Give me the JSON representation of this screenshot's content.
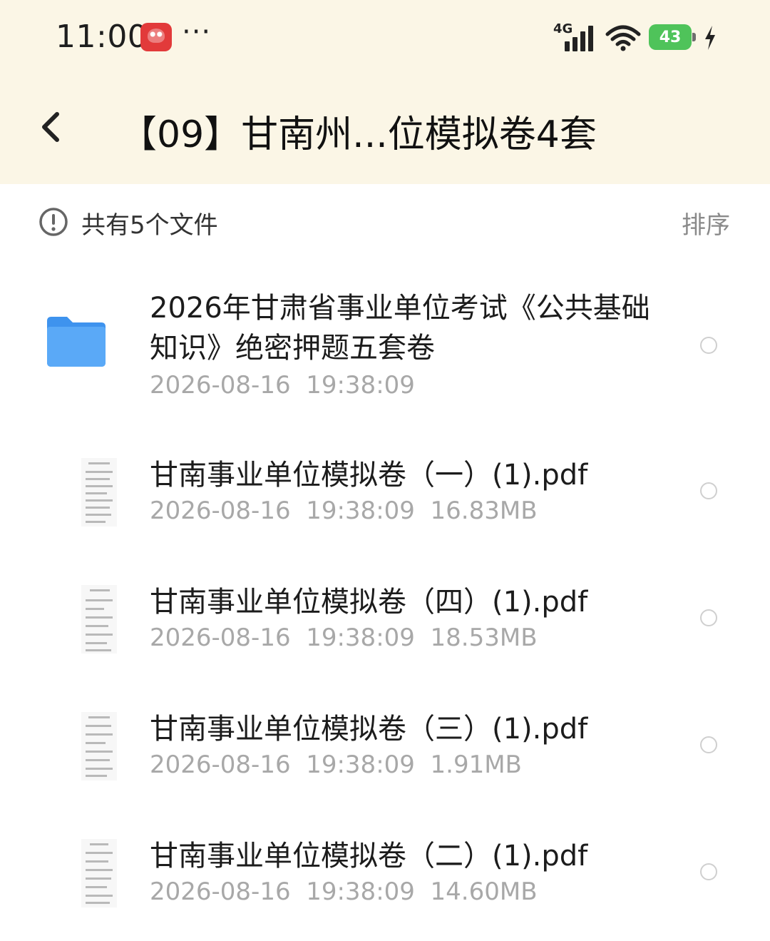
{
  "status_bar": {
    "time": "11:00",
    "more": "···",
    "network": "4G",
    "battery": "43"
  },
  "header": {
    "title": "【09】甘南州...位模拟卷4套"
  },
  "summary": {
    "file_count": "共有5个文件",
    "sort_label": "排序"
  },
  "files": [
    {
      "type": "folder",
      "name": "2026年甘肃省事业单位考试《公共基础知识》绝密押题五套卷",
      "meta": "2026-08-16  19:38:09"
    },
    {
      "type": "pdf",
      "name": "甘南事业单位模拟卷（一）(1).pdf",
      "meta": "2026-08-16  19:38:09  16.83MB"
    },
    {
      "type": "pdf",
      "name": "甘南事业单位模拟卷（四）(1).pdf",
      "meta": "2026-08-16  19:38:09  18.53MB"
    },
    {
      "type": "pdf",
      "name": "甘南事业单位模拟卷（三）(1).pdf",
      "meta": "2026-08-16  19:38:09  1.91MB"
    },
    {
      "type": "pdf",
      "name": "甘南事业单位模拟卷（二）(1).pdf",
      "meta": "2026-08-16  19:38:09  14.60MB"
    }
  ],
  "colors": {
    "header_bg": "#fbf6e6",
    "folder_blue": "#4a9ff5",
    "battery_green": "#4fc35a",
    "meta_gray": "#a8a8a8"
  }
}
